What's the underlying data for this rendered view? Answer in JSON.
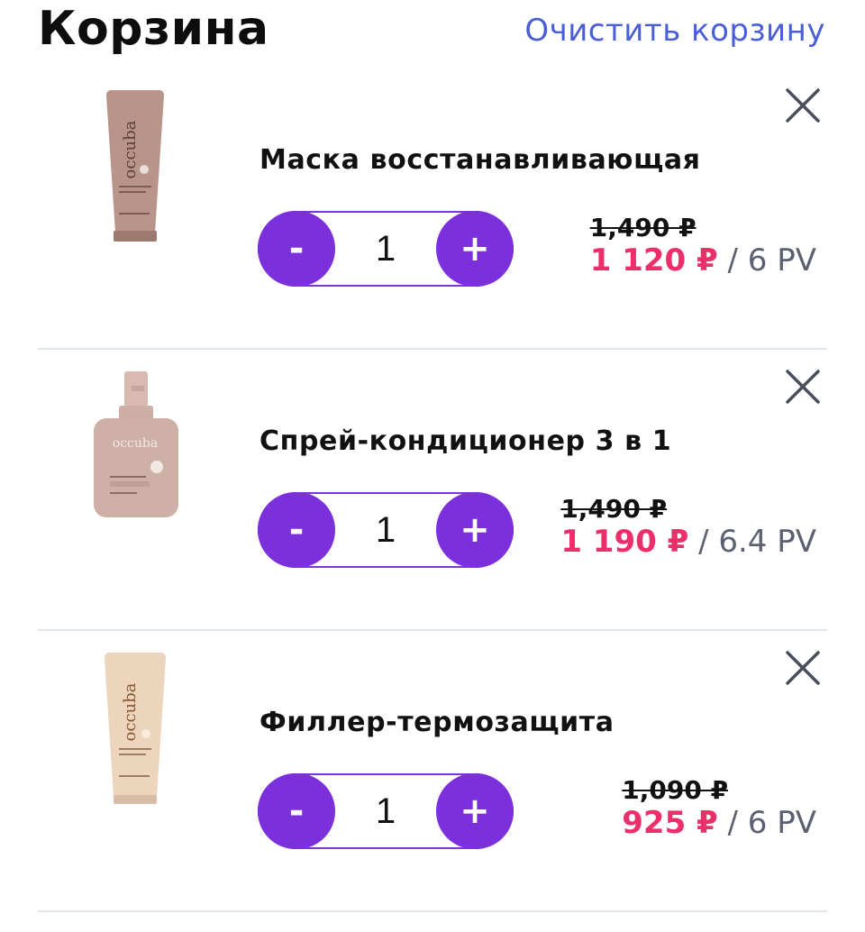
{
  "header": {
    "title": "Корзина",
    "clear_label": "Очистить корзину"
  },
  "colors": {
    "accent": "#7b30dc",
    "price": "#ea2f6b",
    "link": "#4a5ed6"
  },
  "items": [
    {
      "name": "Маска восстанавливающая",
      "quantity": "1",
      "old_price": "1,490 ₽",
      "price": "1 120 ₽",
      "pv": " / 6 PV",
      "minus_label": "-",
      "plus_label": "+",
      "image": "tube-mauve",
      "brand": "occuba"
    },
    {
      "name": "Спрей-кондиционер 3 в 1",
      "quantity": "1",
      "old_price": "1,490 ₽",
      "price": "1 190 ₽",
      "pv": " / 6.4 PV",
      "minus_label": "-",
      "plus_label": "+",
      "image": "spray-bottle",
      "brand": "occuba"
    },
    {
      "name": "Филлер-термозащита",
      "quantity": "1",
      "old_price": "1,090 ₽",
      "price": "925 ₽",
      "pv": " / 6 PV",
      "minus_label": "-",
      "plus_label": "+",
      "image": "tube-beige",
      "brand": "occuba"
    }
  ]
}
